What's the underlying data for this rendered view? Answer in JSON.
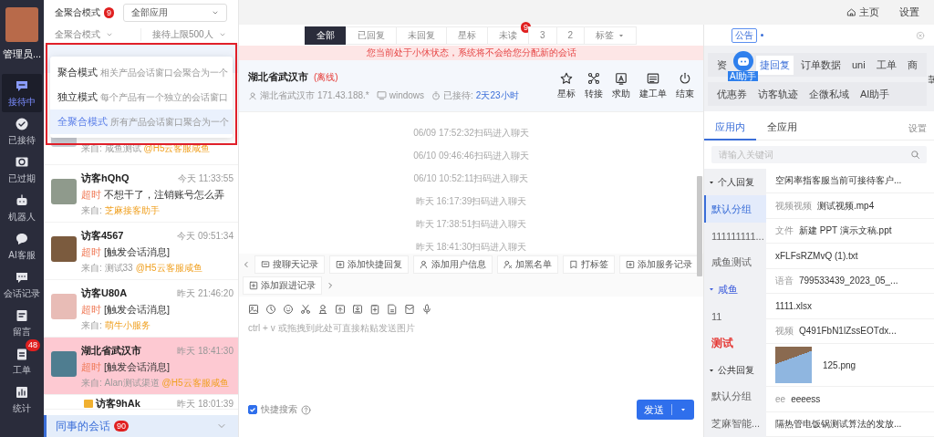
{
  "nav": {
    "user_name": "管理员...",
    "items": [
      {
        "label": "接待中",
        "selected": true
      },
      {
        "label": "已接待",
        "selected": false
      },
      {
        "label": "已过期",
        "selected": false
      },
      {
        "label": "机器人",
        "selected": false
      },
      {
        "label": "AI客服",
        "selected": false
      },
      {
        "label": "会话记录",
        "selected": false
      },
      {
        "label": "留言",
        "selected": false
      },
      {
        "label": "工单",
        "selected": false,
        "badge": "48"
      },
      {
        "label": "统计",
        "selected": false
      }
    ]
  },
  "list_header": {
    "mode": "全聚合模式",
    "mode_badge": "9",
    "app_select": "全部应用",
    "mode_select": "全聚合模式",
    "limit_select": "接待上限500人"
  },
  "mode_menu": [
    {
      "title": "聚合模式",
      "desc": "相关产品会话窗口会聚合为一个",
      "selected": false
    },
    {
      "title": "独立模式",
      "desc": "每个产品有一个独立的会话窗口",
      "selected": false
    },
    {
      "title": "全聚合模式",
      "desc": "所有产品会话窗口聚合为一个",
      "selected": true
    }
  ],
  "conversations": [
    {
      "from": "来自: 咸鱼测试",
      "channel": "@H5云客服咸鱼",
      "selected": false
    },
    {
      "name": "访客hQhQ",
      "time": "今天 11:33:55",
      "status": "超时",
      "message": "不想干了，注销账号怎么弄",
      "from": "来自:",
      "channel": "芝麻接客助手",
      "selected": false
    },
    {
      "name": "访客4567",
      "time": "今天 09:51:34",
      "status": "超时",
      "message": "[触发会话消息]",
      "from": "来自: 测试33",
      "channel": "@H5云客服咸鱼",
      "selected": false
    },
    {
      "name": "访客U80A",
      "time": "昨天 21:46:20",
      "status": "超时",
      "message": "[触发会话消息]",
      "from": "来自:",
      "channel": "萌牛小服务",
      "selected": false
    },
    {
      "name": "湖北省武汉市",
      "time": "昨天 18:41:30",
      "status": "超时",
      "message": "[触发会话消息]",
      "from": "来自: Alan测试渠道",
      "channel": "@H5云客服咸鱼",
      "selected": true
    },
    {
      "name": "访客9hAk",
      "time": "昨天 18:01:39",
      "selected": false
    }
  ],
  "colleague_bar": {
    "label": "同事的会话",
    "badge": "90"
  },
  "topbar": {
    "home": "主页",
    "settings": "设置"
  },
  "filters": [
    {
      "label": "全部",
      "selected": true
    },
    {
      "label": "已回复",
      "selected": false
    },
    {
      "label": "未回复",
      "selected": false
    },
    {
      "label": "星标",
      "selected": false
    },
    {
      "label": "未读",
      "selected": false,
      "badge": "9"
    },
    {
      "label": "3",
      "selected": false
    },
    {
      "label": "2",
      "selected": false
    },
    {
      "label": "标签",
      "selected": false,
      "kind": "dropdown"
    }
  ],
  "announcement": {
    "tag": "公告"
  },
  "notice": "您当前处于小休状态，系统将不会给您分配新的会话",
  "chat_header": {
    "title": "湖北省武汉市",
    "status": "(离线)",
    "location": "湖北省武汉市",
    "ip": "171.43.188.*",
    "os": "windows",
    "duration_label": "已接待:",
    "duration": "2天23小时",
    "actions": [
      "星标",
      "转接",
      "求助",
      "建工单",
      "结束"
    ]
  },
  "messages": [
    "06/09 17:52:32扫码进入聊天",
    "06/10 09:46:46扫码进入聊天",
    "06/10 10:52:11扫码进入聊天",
    "昨天 16:17:39扫码进入聊天",
    "昨天 17:38:51扫码进入聊天",
    "昨天 18:41:30扫码进入聊天"
  ],
  "quick_actions": [
    "搜聊天记录",
    "添加快捷回复",
    "添加用户信息",
    "加黑名单",
    "打标签",
    "添加服务记录",
    "添加跟进记录"
  ],
  "composer": {
    "placeholder": "ctrl + v 或拖拽到此处可直接粘贴发送图片",
    "quick_search": {
      "label": "快捷搜索",
      "checked": true
    },
    "send": "发送"
  },
  "side_tabs": [
    {
      "label": "资",
      "selected": false
    },
    {
      "label": "捷回复",
      "selected": true
    },
    {
      "label": "订单数据",
      "selected": false
    },
    {
      "label": "uni",
      "selected": false
    },
    {
      "label": "工单",
      "selected": false
    },
    {
      "label": "商",
      "selected": false
    },
    {
      "label": "优惠券",
      "selected": false
    },
    {
      "label": "访客轨迹",
      "selected": false
    },
    {
      "label": "企微私域",
      "selected": false
    },
    {
      "label": "AI助手",
      "selected": false
    }
  ],
  "ai_badge": "AI助手",
  "reply_tabs": [
    {
      "label": "应用内",
      "selected": true
    },
    {
      "label": "全应用",
      "selected": false
    }
  ],
  "reply_settings": "设置",
  "reply_search": {
    "placeholder": "请输入关键词"
  },
  "reply_groups": [
    {
      "label": "个人回复",
      "expanded": true,
      "children": [
        {
          "label": "默认分组",
          "selected": true
        },
        {
          "label": "111111111...",
          "selected": false
        },
        {
          "label": "咸鱼测试",
          "selected": false
        }
      ]
    },
    {
      "label": "咸鱼",
      "expanded": true,
      "color": "#3b5bdb",
      "children": [
        {
          "label": "11",
          "selected": false
        },
        {
          "label": "测试",
          "selected": false,
          "color": "#e53935"
        }
      ]
    },
    {
      "label": "公共回复",
      "expanded": true,
      "children": [
        {
          "label": "默认分组",
          "selected": false
        },
        {
          "label": "芝麻智能...",
          "selected": false
        }
      ]
    }
  ],
  "replies": [
    {
      "kind": "text",
      "text": "空闲率指客服当前可接待客户..."
    },
    {
      "kind": "labeled",
      "label": "视频视频",
      "text": "测试视频.mp4"
    },
    {
      "kind": "labeled",
      "label": "文件",
      "text": "新建 PPT 演示文稿.ppt"
    },
    {
      "kind": "text",
      "text": "xFLFsRZMvQ (1).txt"
    },
    {
      "kind": "labeled",
      "label": "语音",
      "text": "799533439_2023_05_..."
    },
    {
      "kind": "text",
      "text": "1111.xlsx"
    },
    {
      "kind": "labeled",
      "label": "视频",
      "text": "Q491FbN1lZssEOTdx..."
    },
    {
      "kind": "image",
      "text": "125.png"
    },
    {
      "kind": "labeled",
      "label": "ee",
      "text": "eeeess"
    },
    {
      "kind": "text",
      "text": "隔热管电饭锅测试算法的发放..."
    }
  ]
}
